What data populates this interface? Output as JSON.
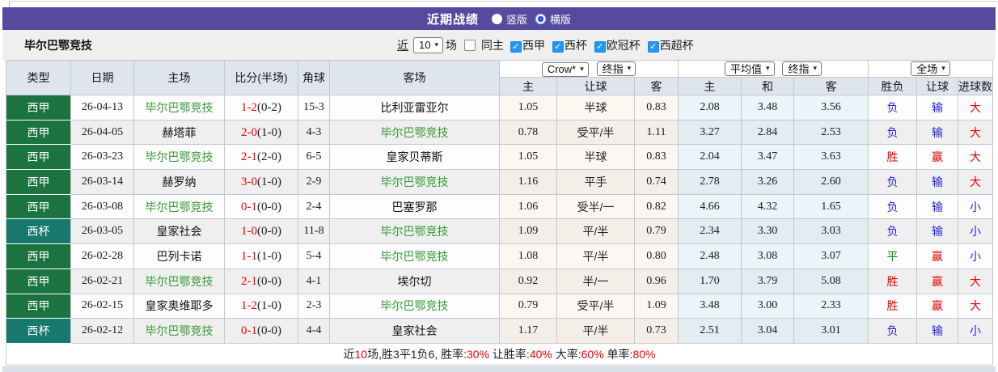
{
  "header": {
    "title": "近期战绩",
    "radio_vertical": "竖版",
    "radio_horizontal": "横版",
    "horizontal_selected": true
  },
  "toolbar": {
    "team_name": "毕尔巴鄂竞技",
    "recent_label": "近",
    "recent_value": "10",
    "matches_label": "场",
    "same_home_label": "同主",
    "same_home_checked": false,
    "league_filters": [
      {
        "label": "西甲",
        "checked": true
      },
      {
        "label": "西杯",
        "checked": true
      },
      {
        "label": "欧冠杯",
        "checked": true
      },
      {
        "label": "西超杯",
        "checked": true
      }
    ]
  },
  "icons": {
    "checkbox_check": "✓",
    "select_arrow": "▾",
    "radio_circle": "●"
  },
  "table": {
    "group_headers": {
      "handicap_source": "Crow*",
      "handicap_stage": "终指",
      "europe_source": "平均值",
      "europe_stage": "终指",
      "scope": "全场"
    },
    "columns": [
      "类型",
      "日期",
      "主场",
      "比分(半场)",
      "角球",
      "客场",
      "主",
      "让球",
      "客",
      "主",
      "和",
      "客",
      "胜负",
      "让球",
      "进球数"
    ],
    "rows": [
      {
        "type": "西甲",
        "date": "26-04-13",
        "home": "毕尔巴鄂竞技",
        "home_focus": true,
        "score": "1-2",
        "half": "(0-2)",
        "corner": "15-3",
        "away": "比利亚雷亚尔",
        "away_focus": false,
        "let_home": "1.05",
        "let_line": "半球",
        "let_away": "0.83",
        "avg_home": "2.08",
        "avg_draw": "3.48",
        "avg_away": "3.56",
        "result": "负",
        "let_result": "输",
        "goals": "大"
      },
      {
        "type": "西甲",
        "date": "26-04-05",
        "home": "赫塔菲",
        "home_focus": false,
        "score": "2-0",
        "half": "(1-0)",
        "corner": "4-3",
        "away": "毕尔巴鄂竞技",
        "away_focus": true,
        "let_home": "0.78",
        "let_line": "受平/半",
        "let_away": "1.11",
        "avg_home": "3.27",
        "avg_draw": "2.84",
        "avg_away": "2.53",
        "result": "负",
        "let_result": "输",
        "goals": "大"
      },
      {
        "type": "西甲",
        "date": "26-03-23",
        "home": "毕尔巴鄂竞技",
        "home_focus": true,
        "score": "2-1",
        "half": "(2-0)",
        "corner": "6-5",
        "away": "皇家贝蒂斯",
        "away_focus": false,
        "let_home": "1.05",
        "let_line": "半球",
        "let_away": "0.83",
        "avg_home": "2.04",
        "avg_draw": "3.47",
        "avg_away": "3.63",
        "result": "胜",
        "let_result": "赢",
        "goals": "大"
      },
      {
        "type": "西甲",
        "date": "26-03-14",
        "home": "赫罗纳",
        "home_focus": false,
        "score": "3-0",
        "half": "(1-0)",
        "corner": "2-9",
        "away": "毕尔巴鄂竞技",
        "away_focus": true,
        "let_home": "1.16",
        "let_line": "平手",
        "let_away": "0.74",
        "avg_home": "2.78",
        "avg_draw": "3.26",
        "avg_away": "2.60",
        "result": "负",
        "let_result": "输",
        "goals": "大"
      },
      {
        "type": "西甲",
        "date": "26-03-08",
        "home": "毕尔巴鄂竞技",
        "home_focus": true,
        "score": "0-1",
        "half": "(0-0)",
        "corner": "2-4",
        "away": "巴塞罗那",
        "away_focus": false,
        "let_home": "1.06",
        "let_line": "受半/一",
        "let_away": "0.82",
        "avg_home": "4.66",
        "avg_draw": "4.32",
        "avg_away": "1.65",
        "result": "负",
        "let_result": "输",
        "goals": "小"
      },
      {
        "type": "西杯",
        "date": "26-03-05",
        "home": "皇家社会",
        "home_focus": false,
        "score": "1-0",
        "half": "(0-0)",
        "corner": "11-8",
        "away": "毕尔巴鄂竞技",
        "away_focus": true,
        "let_home": "1.09",
        "let_line": "平/半",
        "let_away": "0.79",
        "avg_home": "2.34",
        "avg_draw": "3.30",
        "avg_away": "3.03",
        "result": "负",
        "let_result": "输",
        "goals": "小"
      },
      {
        "type": "西甲",
        "date": "26-02-28",
        "home": "巴列卡诺",
        "home_focus": false,
        "score": "1-1",
        "half": "(1-0)",
        "corner": "5-4",
        "away": "毕尔巴鄂竞技",
        "away_focus": true,
        "let_home": "1.08",
        "let_line": "平/半",
        "let_away": "0.80",
        "avg_home": "2.48",
        "avg_draw": "3.08",
        "avg_away": "3.07",
        "result": "平",
        "let_result": "赢",
        "goals": "小"
      },
      {
        "type": "西甲",
        "date": "26-02-21",
        "home": "毕尔巴鄂竞技",
        "home_focus": true,
        "score": "2-1",
        "half": "(0-0)",
        "corner": "4-1",
        "away": "埃尔切",
        "away_focus": false,
        "let_home": "0.92",
        "let_line": "半/一",
        "let_away": "0.96",
        "avg_home": "1.70",
        "avg_draw": "3.79",
        "avg_away": "5.08",
        "result": "胜",
        "let_result": "赢",
        "goals": "大"
      },
      {
        "type": "西甲",
        "date": "26-02-15",
        "home": "皇家奥维耶多",
        "home_focus": false,
        "score": "1-2",
        "half": "(1-0)",
        "corner": "2-3",
        "away": "毕尔巴鄂竞技",
        "away_focus": true,
        "let_home": "0.79",
        "let_line": "受平/半",
        "let_away": "1.09",
        "avg_home": "3.48",
        "avg_draw": "3.00",
        "avg_away": "2.33",
        "result": "胜",
        "let_result": "赢",
        "goals": "大"
      },
      {
        "type": "西杯",
        "date": "26-02-12",
        "home": "毕尔巴鄂竞技",
        "home_focus": true,
        "score": "0-1",
        "half": "(0-0)",
        "corner": "4-4",
        "away": "皇家社会",
        "away_focus": false,
        "let_home": "1.17",
        "let_line": "平/半",
        "let_away": "0.73",
        "avg_home": "2.51",
        "avg_draw": "3.04",
        "avg_away": "3.01",
        "result": "负",
        "let_result": "输",
        "goals": "小"
      }
    ]
  },
  "summary": {
    "segments": [
      {
        "t": "近",
        "red": false
      },
      {
        "t": "10",
        "red": true
      },
      {
        "t": "场,胜3平1负6, 胜率:",
        "red": false
      },
      {
        "t": "30%",
        "red": true
      },
      {
        "t": " 让胜率:",
        "red": false
      },
      {
        "t": "40%",
        "red": true
      },
      {
        "t": " 大率:",
        "red": false
      },
      {
        "t": "60%",
        "red": true
      },
      {
        "t": " 单率:",
        "red": false
      },
      {
        "t": "80%",
        "red": true
      }
    ]
  },
  "colors": {
    "accent_purple": "#564A9E",
    "checkbox_blue": "#2196F3",
    "type_bg": {
      "西甲": "#1B7340",
      "西杯": "#17786E"
    },
    "focus_team": "#339933",
    "score_red": "#E60000",
    "result": {
      "胜": "#E60000",
      "负": "#2424D8",
      "平": "#0A8A0A"
    },
    "handicap_result": {
      "赢": "#E60000",
      "输": "#2424D8"
    },
    "goals": {
      "大": "#E60000",
      "小": "#2424D8"
    }
  }
}
